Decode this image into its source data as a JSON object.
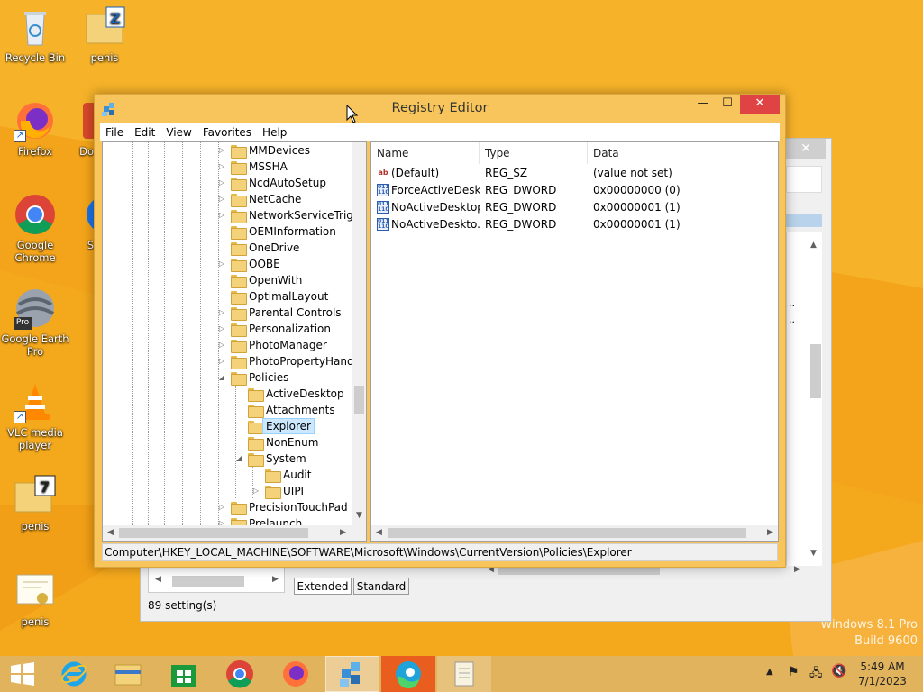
{
  "desktop": {
    "icons": [
      {
        "label": "Recycle Bin",
        "icon": "recycle-bin-icon"
      },
      {
        "label": "penis",
        "icon": "zip-folder-icon"
      },
      {
        "label": "Firefox",
        "icon": "firefox-icon"
      },
      {
        "label": "Do",
        "icon": "document-icon"
      },
      {
        "label": "Google Chrome",
        "icon": "chrome-icon"
      },
      {
        "label": "S",
        "icon": "app-icon"
      },
      {
        "label": "Google Earth Pro",
        "icon": "google-earth-icon"
      },
      {
        "label": "VLC media player",
        "icon": "vlc-icon"
      },
      {
        "label": "penis",
        "icon": "7zip-folder-icon"
      },
      {
        "label": "penis",
        "icon": "certificate-icon"
      }
    ],
    "watermark": {
      "line1": "Windows 8.1 Pro",
      "line2": "Build 9600"
    }
  },
  "back_window": {
    "tabs": [
      "Extended",
      "Standard"
    ],
    "status": "89 setting(s)"
  },
  "registry_editor": {
    "title": "Registry Editor",
    "menu": [
      "File",
      "Edit",
      "View",
      "Favorites",
      "Help"
    ],
    "tree": [
      {
        "label": "MMDevices",
        "level": 0,
        "expander": "▷"
      },
      {
        "label": "MSSHA",
        "level": 0,
        "expander": "▷"
      },
      {
        "label": "NcdAutoSetup",
        "level": 0,
        "expander": "▷"
      },
      {
        "label": "NetCache",
        "level": 0,
        "expander": "▷"
      },
      {
        "label": "NetworkServiceTrigge",
        "level": 0,
        "expander": "▷"
      },
      {
        "label": "OEMInformation",
        "level": 0,
        "expander": ""
      },
      {
        "label": "OneDrive",
        "level": 0,
        "expander": ""
      },
      {
        "label": "OOBE",
        "level": 0,
        "expander": "▷"
      },
      {
        "label": "OpenWith",
        "level": 0,
        "expander": ""
      },
      {
        "label": "OptimalLayout",
        "level": 0,
        "expander": ""
      },
      {
        "label": "Parental Controls",
        "level": 0,
        "expander": "▷"
      },
      {
        "label": "Personalization",
        "level": 0,
        "expander": "▷"
      },
      {
        "label": "PhotoManager",
        "level": 0,
        "expander": "▷"
      },
      {
        "label": "PhotoPropertyHandle",
        "level": 0,
        "expander": "▷"
      },
      {
        "label": "Policies",
        "level": 0,
        "expander": "◢"
      },
      {
        "label": "ActiveDesktop",
        "level": 1,
        "expander": ""
      },
      {
        "label": "Attachments",
        "level": 1,
        "expander": ""
      },
      {
        "label": "Explorer",
        "level": 1,
        "expander": "",
        "selected": true
      },
      {
        "label": "NonEnum",
        "level": 1,
        "expander": ""
      },
      {
        "label": "System",
        "level": 1,
        "expander": "◢"
      },
      {
        "label": "Audit",
        "level": 2,
        "expander": ""
      },
      {
        "label": "UIPI",
        "level": 2,
        "expander": "▷"
      },
      {
        "label": "PrecisionTouchPad",
        "level": 0,
        "expander": "▷"
      },
      {
        "label": "Prelaunch",
        "level": 0,
        "expander": "▷"
      }
    ],
    "columns": {
      "name": "Name",
      "type": "Type",
      "data": "Data"
    },
    "values": [
      {
        "name": "(Default)",
        "type": "REG_SZ",
        "data": "(value not set)",
        "icon": "string-value-icon",
        "icon_text": "ab"
      },
      {
        "name": "ForceActiveDesk...",
        "type": "REG_DWORD",
        "data": "0x00000000 (0)",
        "icon": "binary-value-icon",
        "icon_text": "011 110"
      },
      {
        "name": "NoActiveDesktop",
        "type": "REG_DWORD",
        "data": "0x00000001 (1)",
        "icon": "binary-value-icon",
        "icon_text": "011 110"
      },
      {
        "name": "NoActiveDeskto...",
        "type": "REG_DWORD",
        "data": "0x00000001 (1)",
        "icon": "binary-value-icon",
        "icon_text": "011 110"
      }
    ],
    "status_path": "Computer\\HKEY_LOCAL_MACHINE\\SOFTWARE\\Microsoft\\Windows\\CurrentVersion\\Policies\\Explorer"
  },
  "taskbar": {
    "items": [
      {
        "name": "start-button",
        "icon": "windows-start-icon"
      },
      {
        "name": "internet-explorer",
        "icon": "internet-explorer-icon"
      },
      {
        "name": "file-explorer",
        "icon": "file-explorer-icon"
      },
      {
        "name": "store",
        "icon": "store-icon"
      },
      {
        "name": "chrome",
        "icon": "chrome-icon"
      },
      {
        "name": "firefox",
        "icon": "firefox-icon"
      },
      {
        "name": "registry-editor",
        "icon": "registry-editor-icon",
        "active": true
      },
      {
        "name": "edge",
        "icon": "edge-icon"
      },
      {
        "name": "notepad",
        "icon": "notepad-icon"
      }
    ],
    "clock": {
      "time": "5:49 AM",
      "date": "7/1/2023"
    }
  },
  "colors": {
    "desktop": "#f4a81c",
    "window_frame": "#f7c55b",
    "close_button": "#e04343",
    "selection": "#cce8ff"
  }
}
